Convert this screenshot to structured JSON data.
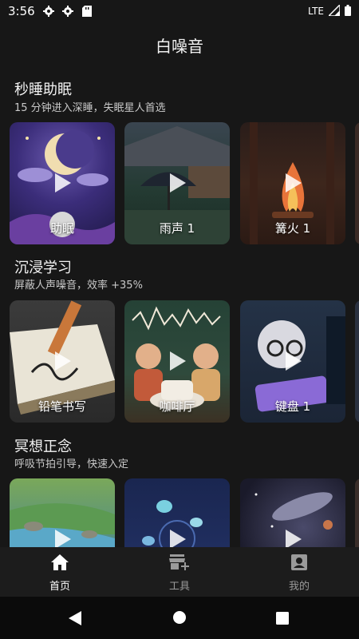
{
  "status": {
    "time": "3:56",
    "network": "LTE",
    "icons": [
      "gear-icon",
      "gear-icon",
      "sd-card-icon"
    ]
  },
  "app_title": "白噪音",
  "sections": [
    {
      "title": "秒睡助眠",
      "subtitle": "15 分钟进入深睡，失眠星人首选",
      "cards": [
        {
          "label": "助眠"
        },
        {
          "label": "雨声 1"
        },
        {
          "label": "篝火 1"
        }
      ]
    },
    {
      "title": "沉浸学习",
      "subtitle": "屏蔽人声噪音，效率 +35%",
      "cards": [
        {
          "label": "铅笔书写"
        },
        {
          "label": "咖啡厅"
        },
        {
          "label": "键盘 1"
        }
      ]
    },
    {
      "title": "冥想正念",
      "subtitle": "呼吸节拍引导，快速入定",
      "cards": [
        {
          "label": ""
        },
        {
          "label": ""
        },
        {
          "label": ""
        }
      ]
    }
  ],
  "bottom_nav": {
    "items": [
      {
        "label": "首页",
        "icon": "home-icon",
        "active": true
      },
      {
        "label": "工具",
        "icon": "store-add-icon",
        "active": false
      },
      {
        "label": "我的",
        "icon": "profile-icon",
        "active": false
      }
    ]
  },
  "colors": {
    "background": "#171717",
    "nav_background": "#1c1c1c",
    "active": "#ffffff",
    "inactive": "#9a9a9a"
  }
}
